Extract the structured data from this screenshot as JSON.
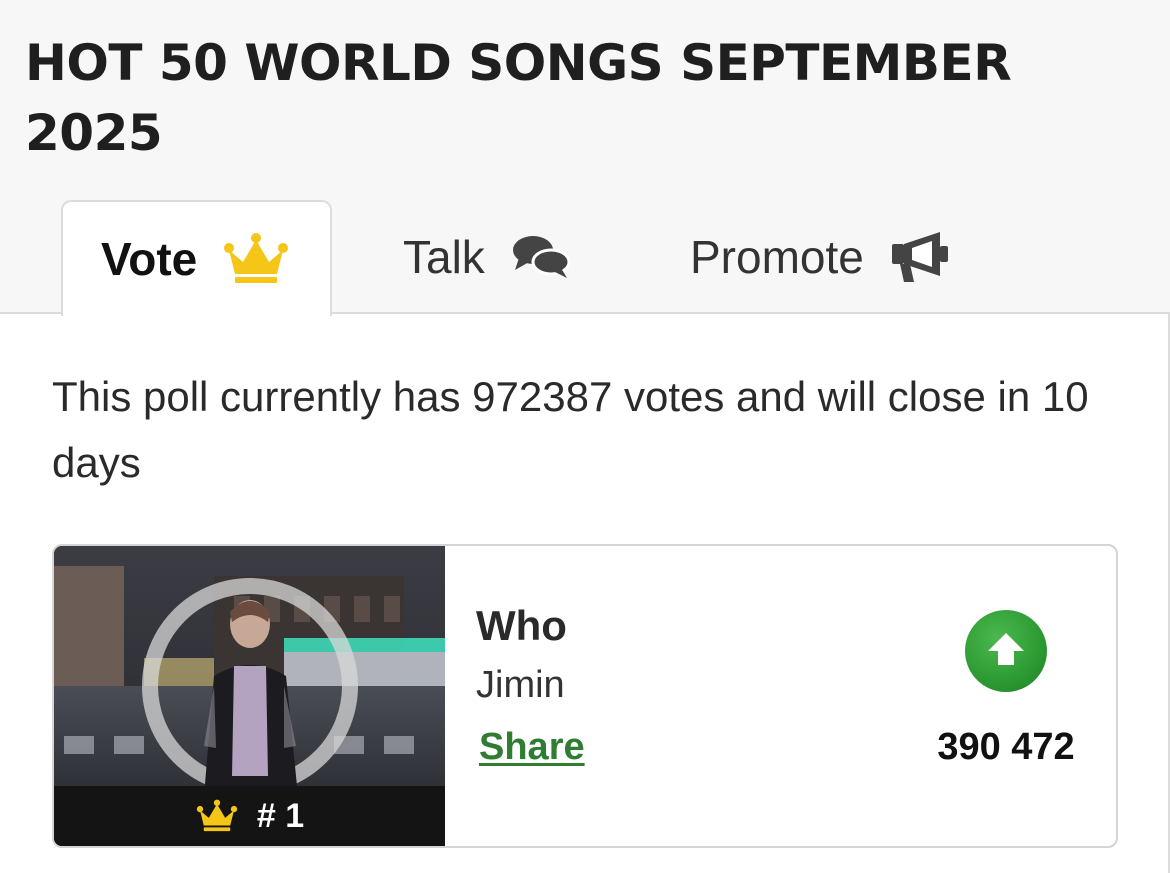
{
  "page": {
    "title": "HOT 50 WORLD SONGS SEPTEMBER 2025"
  },
  "tabs": [
    {
      "label": "Vote",
      "icon": "crown-icon",
      "active": true
    },
    {
      "label": "Talk",
      "icon": "chat-bubbles-icon",
      "active": false
    },
    {
      "label": "Promote",
      "icon": "megaphone-icon",
      "active": false
    }
  ],
  "poll": {
    "info": "This poll currently has 972387 votes and will close in 10 days"
  },
  "entries": [
    {
      "rank": "# 1",
      "title": "Who",
      "artist": "Jimin",
      "share_label": "Share",
      "votes": "390 472",
      "vote_icon": "arrow-up-icon"
    }
  ],
  "colors": {
    "crown": "#f5c518",
    "share_link": "#2e7d32",
    "vote_button": "#2c9a32",
    "tab_border": "#dcdcdc"
  }
}
